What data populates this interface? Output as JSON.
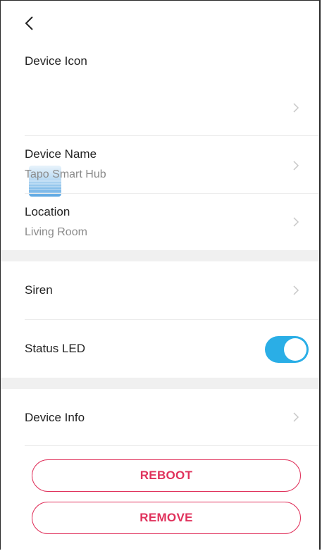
{
  "header": {
    "back_icon": "chevron-left-icon"
  },
  "device_icon": {
    "label": "Device Icon",
    "icon": "hub-device-icon"
  },
  "rows": {
    "device_name": {
      "title": "Device Name",
      "value": "Tapo Smart Hub"
    },
    "location": {
      "title": "Location",
      "value": "Living Room"
    },
    "siren": {
      "title": "Siren"
    },
    "status_led": {
      "title": "Status LED",
      "enabled": true
    },
    "device_info": {
      "title": "Device Info"
    }
  },
  "buttons": {
    "reboot": "REBOOT",
    "remove": "REMOVE"
  },
  "colors": {
    "accent_pink": "#e0325c",
    "toggle_blue": "#2aaee6",
    "separator": "#f0f0f0"
  }
}
